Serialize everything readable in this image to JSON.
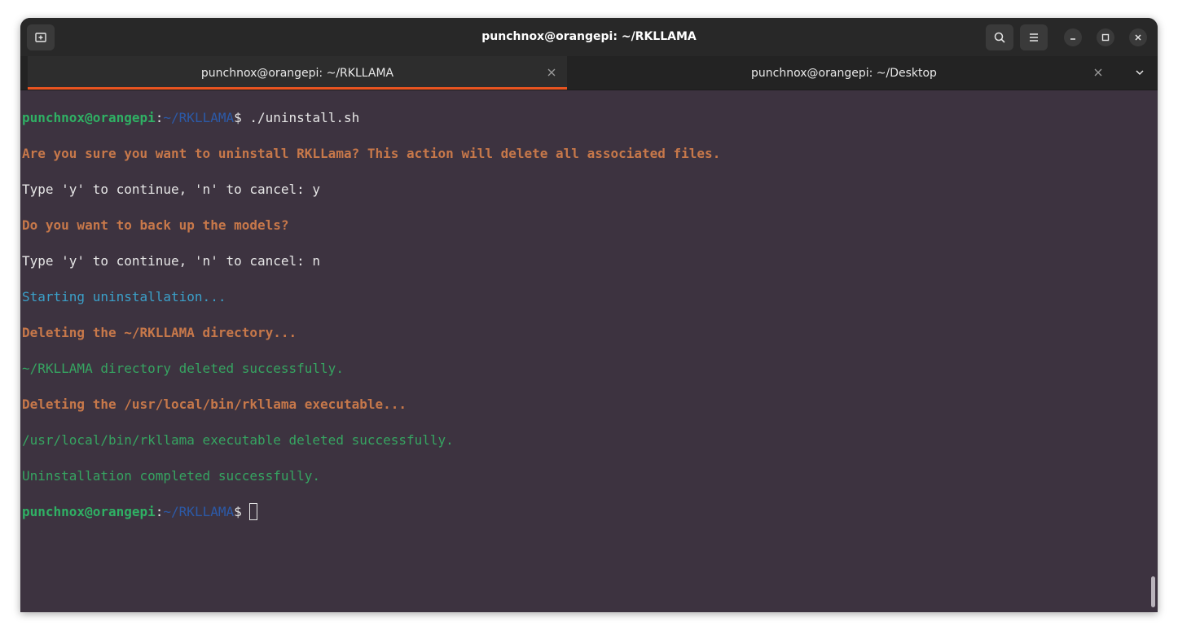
{
  "window": {
    "title": "punchnox@orangepi: ~/RKLLAMA"
  },
  "titlebar": {
    "new_tab_icon": "new-tab-icon",
    "search_icon": "search-icon",
    "menu_icon": "hamburger-menu-icon",
    "minimize_icon": "minimize-icon",
    "maximize_icon": "maximize-icon",
    "close_icon": "close-icon"
  },
  "tabs": [
    {
      "label": "punchnox@orangepi: ~/RKLLAMA",
      "active": true
    },
    {
      "label": "punchnox@orangepi: ~/Desktop",
      "active": false
    }
  ],
  "colors": {
    "accent": "#e95420",
    "terminal_bg": "#3d3340",
    "prompt_user": "#2fb164",
    "prompt_path": "#2c5aa8",
    "warning": "#c7784a",
    "info": "#3ba0c9",
    "success": "#36a461"
  },
  "terminal": {
    "prompt_user": "punchnox@orangepi",
    "prompt_sep": ":",
    "prompt_path": "~/RKLLAMA",
    "prompt_symbol": "$ ",
    "command": "./uninstall.sh",
    "lines": [
      "Are you sure you want to uninstall RKLLama? This action will delete all associated files.",
      "Type 'y' to continue, 'n' to cancel: y",
      "Do you want to back up the models?",
      "Type 'y' to continue, 'n' to cancel: n",
      "Starting uninstallation...",
      "Deleting the ~/RKLLAMA directory...",
      "~/RKLLAMA directory deleted successfully.",
      "Deleting the /usr/local/bin/rkllama executable...",
      "/usr/local/bin/rkllama executable deleted successfully.",
      "Uninstallation completed successfully."
    ]
  }
}
